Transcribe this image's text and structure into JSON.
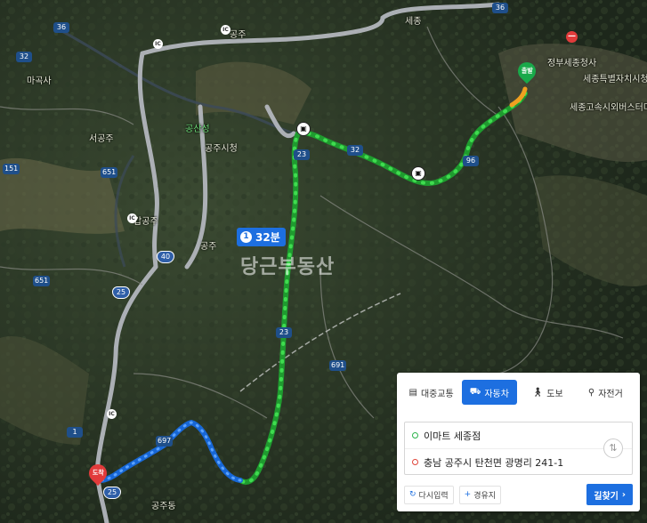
{
  "map": {
    "places": [
      {
        "id": "masan",
        "text": "마곡사"
      },
      {
        "id": "gonggju",
        "text": "공주"
      },
      {
        "id": "seonggju",
        "text": "서공주"
      },
      {
        "id": "gongjusi",
        "text": "공주시청"
      },
      {
        "id": "gonsanseong",
        "text": "공산성"
      },
      {
        "id": "ganggong",
        "text": "갑공주"
      },
      {
        "id": "sejong",
        "text": "세종"
      },
      {
        "id": "jeongbu",
        "text": "정부세종청사"
      },
      {
        "id": "sejongsi",
        "text": "세종특별자치시청"
      },
      {
        "id": "sejongexp",
        "text": "세종고속시외버스터미널"
      },
      {
        "id": "gongjuic",
        "text": "공주"
      },
      {
        "id": "dest_area",
        "text": "공주동"
      }
    ],
    "route_badge": {
      "index": "1",
      "time": "32분"
    },
    "watermark": "당근부동산",
    "start_label": "출발",
    "end_label": "도착",
    "road_numbers": [
      "36",
      "32",
      "23",
      "96",
      "40",
      "25",
      "691",
      "697",
      "651",
      "1",
      "151"
    ]
  },
  "panel": {
    "modes": [
      {
        "key": "transit",
        "label": "대중교통",
        "icon": "bus-icon",
        "active": false
      },
      {
        "key": "car",
        "label": "자동차",
        "icon": "car-icon",
        "active": true
      },
      {
        "key": "walk",
        "label": "도보",
        "icon": "walk-icon",
        "active": false
      },
      {
        "key": "bike",
        "label": "자전거",
        "icon": "bike-icon",
        "active": false
      }
    ],
    "origin": "이마트 세종점",
    "destination": "충남 공주시 탄천면 광명리 241-1",
    "reset_label": "다시입력",
    "waypoint_label": "경유지",
    "go_label": "길찾기"
  },
  "colors": {
    "accent": "#1d6fe0",
    "route_green": "#2ecc40",
    "route_blue": "#1a73e8",
    "start": "#19a94a",
    "end": "#e23b3b"
  }
}
